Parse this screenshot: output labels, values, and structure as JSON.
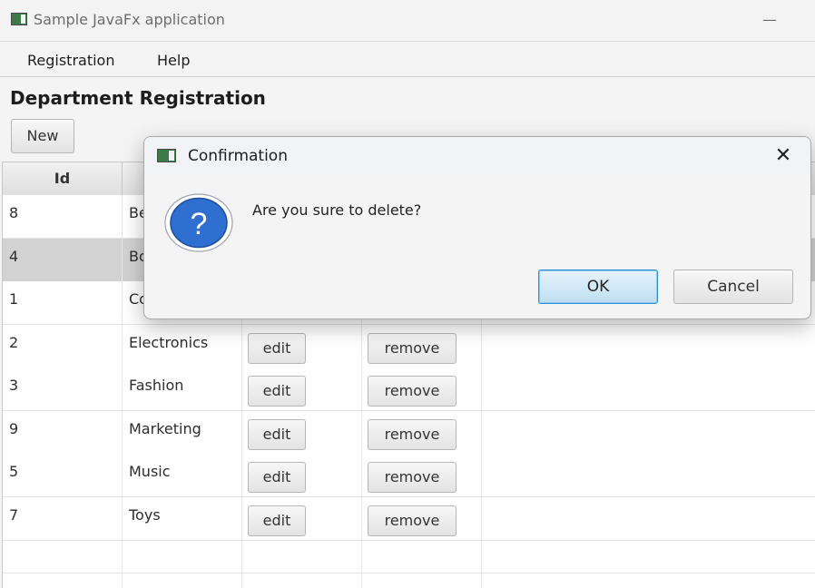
{
  "window": {
    "title": "Sample JavaFx application",
    "minimize_glyph": "—"
  },
  "menu": {
    "items": [
      "Registration",
      "Help"
    ]
  },
  "page": {
    "title": "Department Registration",
    "new_button": "New"
  },
  "table": {
    "headers": [
      "Id",
      "",
      "",
      ""
    ],
    "rows": [
      {
        "id": "8",
        "name": "Be",
        "selected": false,
        "buttons_hidden": true
      },
      {
        "id": "4",
        "name": "Bo",
        "selected": true,
        "buttons_hidden": true
      },
      {
        "id": "1",
        "name": "Co",
        "selected": false,
        "buttons_hidden": true
      },
      {
        "id": "2",
        "name": "Electronics",
        "selected": false,
        "edit": "edit",
        "remove": "remove"
      },
      {
        "id": "3",
        "name": "Fashion",
        "selected": false,
        "edit": "edit",
        "remove": "remove"
      },
      {
        "id": "9",
        "name": "Marketing",
        "selected": false,
        "edit": "edit",
        "remove": "remove"
      },
      {
        "id": "5",
        "name": "Music",
        "selected": false,
        "edit": "edit",
        "remove": "remove"
      },
      {
        "id": "7",
        "name": "Toys",
        "selected": false,
        "edit": "edit",
        "remove": "remove"
      }
    ]
  },
  "dialog": {
    "title": "Confirmation",
    "close_glyph": "✕",
    "message": "Are you sure to delete?",
    "icon": "question-icon",
    "ok_label": "OK",
    "cancel_label": "Cancel"
  },
  "colors": {
    "question_blue": "#2f6fcf",
    "ok_border": "#2b8fd6",
    "selected_row": "#d2d2d2"
  }
}
